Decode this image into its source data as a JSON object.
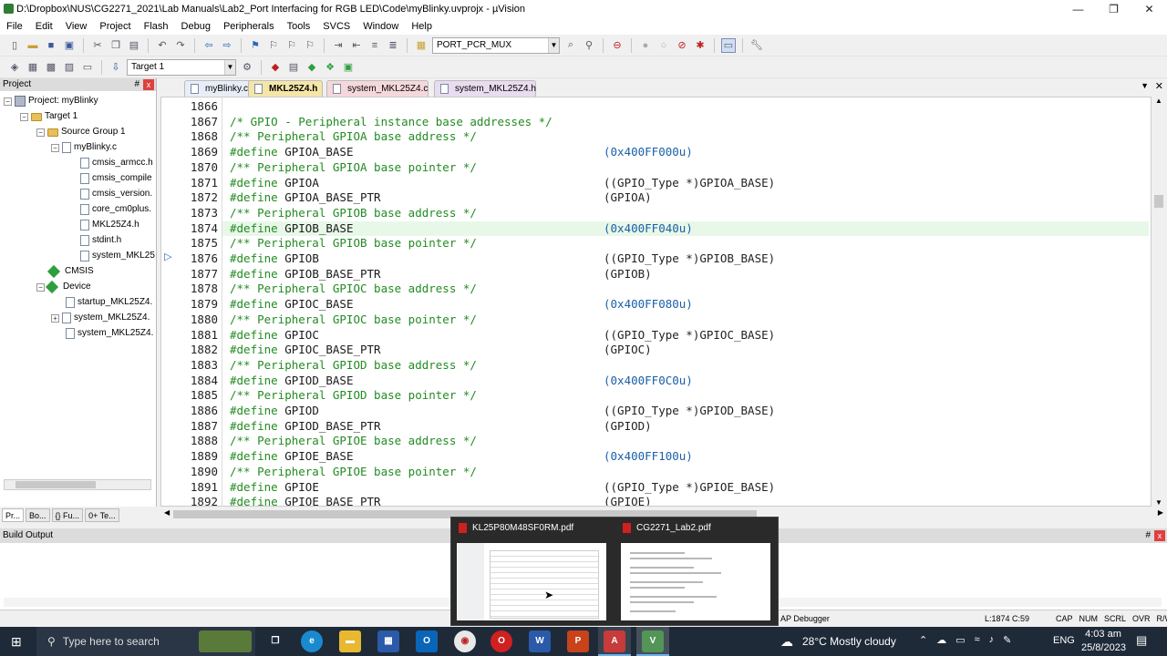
{
  "window": {
    "title": "D:\\Dropbox\\NUS\\CG2271_2021\\Lab Manuals\\Lab2_Port Interfacing for RGB LED\\Code\\myBlinky.uvprojx - µVision",
    "minimize": "—",
    "maximize": "❐",
    "close": "✕"
  },
  "menu": [
    "File",
    "Edit",
    "View",
    "Project",
    "Flash",
    "Debug",
    "Peripherals",
    "Tools",
    "SVCS",
    "Window",
    "Help"
  ],
  "toolbar": {
    "find_combo": "PORT_PCR_MUX",
    "target_combo": "Target 1"
  },
  "project_panel": {
    "title": "Project",
    "close": "x",
    "pin": "#",
    "tree": [
      {
        "label": "Project: myBlinky",
        "icon": "project-icon"
      },
      {
        "label": "Target 1",
        "icon": "folder-icon"
      },
      {
        "label": "Source Group 1",
        "icon": "folder-icon"
      },
      {
        "label": "myBlinky.c",
        "icon": "file-icon"
      },
      {
        "label": "cmsis_armcc.h",
        "icon": "file-icon"
      },
      {
        "label": "cmsis_compile",
        "icon": "file-icon"
      },
      {
        "label": "cmsis_version.",
        "icon": "file-icon"
      },
      {
        "label": "core_cm0plus.",
        "icon": "file-icon"
      },
      {
        "label": "MKL25Z4.h",
        "icon": "file-icon"
      },
      {
        "label": "stdint.h",
        "icon": "file-icon"
      },
      {
        "label": "system_MKL25",
        "icon": "file-icon"
      },
      {
        "label": "CMSIS",
        "icon": "diamond-icon"
      },
      {
        "label": "Device",
        "icon": "diamond-icon"
      },
      {
        "label": "startup_MKL25Z4.",
        "icon": "file-icon"
      },
      {
        "label": "system_MKL25Z4.",
        "icon": "file-icon"
      },
      {
        "label": "system_MKL25Z4.",
        "icon": "file-icon"
      }
    ],
    "tabs": [
      "Pr...",
      "Bo...",
      "{} Fu...",
      "0+ Te..."
    ]
  },
  "file_tabs": [
    {
      "label": "myBlinky.c",
      "active": false
    },
    {
      "label": "MKL25Z4.h",
      "active": true
    },
    {
      "label": "system_MKL25Z4.c",
      "active": false
    },
    {
      "label": "system_MKL25Z4.h",
      "active": false
    }
  ],
  "editor": {
    "lines": [
      {
        "n": "1866",
        "code": "",
        "value": ""
      },
      {
        "n": "1867",
        "code": "/* GPIO - Peripheral instance base addresses */",
        "value": "",
        "comment": true
      },
      {
        "n": "1868",
        "code": "/** Peripheral GPIOA base address */",
        "value": "",
        "comment": true
      },
      {
        "n": "1869",
        "code": "#define GPIOA_BASE",
        "value": "(0x400FF000u)"
      },
      {
        "n": "1870",
        "code": "/** Peripheral GPIOA base pointer */",
        "value": "",
        "comment": true
      },
      {
        "n": "1871",
        "code": "#define GPIOA",
        "value": "((GPIO_Type *)GPIOA_BASE)"
      },
      {
        "n": "1872",
        "code": "#define GPIOA_BASE_PTR",
        "value": "(GPIOA)"
      },
      {
        "n": "1873",
        "code": "/** Peripheral GPIOB base address */",
        "value": "",
        "comment": true
      },
      {
        "n": "1874",
        "code": "#define GPIOB_BASE",
        "value": "(0x400FF040u)"
      },
      {
        "n": "1875",
        "code": "/** Peripheral GPIOB base pointer */",
        "value": "",
        "comment": true
      },
      {
        "n": "1876",
        "code": "#define GPIOB",
        "value": "((GPIO_Type *)GPIOB_BASE)"
      },
      {
        "n": "1877",
        "code": "#define GPIOB_BASE_PTR",
        "value": "(GPIOB)"
      },
      {
        "n": "1878",
        "code": "/** Peripheral GPIOC base address */",
        "value": "",
        "comment": true
      },
      {
        "n": "1879",
        "code": "#define GPIOC_BASE",
        "value": "(0x400FF080u)"
      },
      {
        "n": "1880",
        "code": "/** Peripheral GPIOC base pointer */",
        "value": "",
        "comment": true
      },
      {
        "n": "1881",
        "code": "#define GPIOC",
        "value": "((GPIO_Type *)GPIOC_BASE)"
      },
      {
        "n": "1882",
        "code": "#define GPIOC_BASE_PTR",
        "value": "(GPIOC)"
      },
      {
        "n": "1883",
        "code": "/** Peripheral GPIOD base address */",
        "value": "",
        "comment": true
      },
      {
        "n": "1884",
        "code": "#define GPIOD_BASE",
        "value": "(0x400FF0C0u)"
      },
      {
        "n": "1885",
        "code": "/** Peripheral GPIOD base pointer */",
        "value": "",
        "comment": true
      },
      {
        "n": "1886",
        "code": "#define GPIOD",
        "value": "((GPIO_Type *)GPIOD_BASE)"
      },
      {
        "n": "1887",
        "code": "#define GPIOD_BASE_PTR",
        "value": "(GPIOD)"
      },
      {
        "n": "1888",
        "code": "/** Peripheral GPIOE base address */",
        "value": "",
        "comment": true
      },
      {
        "n": "1889",
        "code": "#define GPIOE_BASE",
        "value": "(0x400FF100u)"
      },
      {
        "n": "1890",
        "code": "/** Peripheral GPIOE base pointer */",
        "value": "",
        "comment": true
      },
      {
        "n": "1891",
        "code": "#define GPIOE",
        "value": "((GPIO_Type *)GPIOE_BASE)"
      },
      {
        "n": "1892",
        "code": "#define GPIOE_BASE_PTR",
        "value": "(GPIOE)"
      }
    ],
    "highlighted_line": "1874"
  },
  "build_output": {
    "title": "Build Output",
    "close": "x",
    "pin": "#"
  },
  "statusbar": {
    "debugger": "AP Debugger",
    "position": "L:1874 C:59",
    "indicators": [
      "CAP",
      "NUM",
      "SCRL",
      "OVR",
      "R/W"
    ]
  },
  "thumbnails": [
    {
      "label": "KL25P80M48SF0RM.pdf"
    },
    {
      "label": "CG2271_Lab2.pdf"
    }
  ],
  "taskbar": {
    "search_placeholder": "Type here to search",
    "weather": "28°C  Mostly cloudy",
    "lang": "ENG",
    "time": "4:03 am",
    "date": "25/8/2023",
    "apps": [
      "W",
      "P",
      "A",
      "V"
    ]
  }
}
